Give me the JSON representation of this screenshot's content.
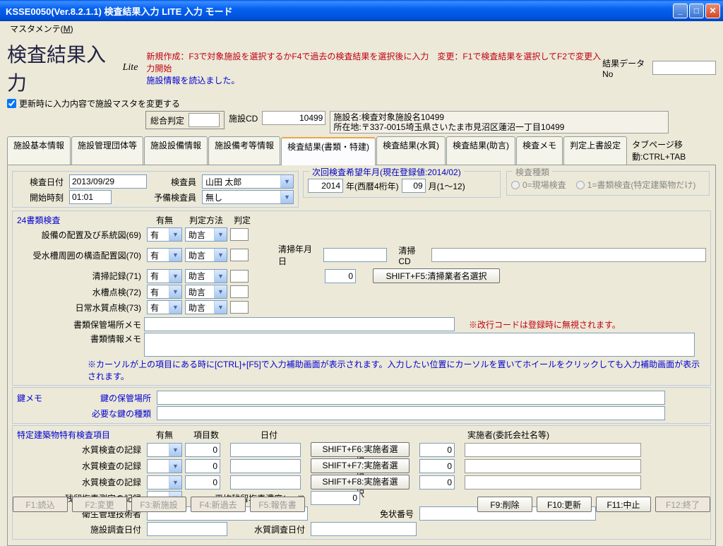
{
  "window": {
    "title": "KSSE0050(Ver.8.2.1.1) 検査結果入力 LITE 入力 モード"
  },
  "menu": {
    "master": "マスタメンテ(",
    "master_u": "M",
    "master_after": ")"
  },
  "header": {
    "page_title": "検査結果入力",
    "lite": "Lite",
    "instruction": "新規作成：F3で対象施設を選択するかF4で過去の検査結果を選択後に入力　変更：F1で検査結果を選択してF2で変更入力開始",
    "loaded": "施設情報を読込ました。",
    "checkbox_label": "更新時に入力内容で施設マスタを変更する",
    "result_data_no_label": "結果データNo",
    "result_data_no": "",
    "overall_label": "総合判定",
    "overall_value": "",
    "facility_cd_label": "施設CD",
    "facility_cd": "10499",
    "facility_name": "施設名:検査対象施設名10499",
    "facility_addr": "所在地:〒337-0015埼玉県さいたま市見沼区蓮沼一丁目10499"
  },
  "tabs": {
    "t1": "施設基本情報",
    "t2": "施設管理団体等",
    "t3": "施設設備情報",
    "t4": "施設備考等情報",
    "t5": "検査結果(書類・特建)",
    "t6": "検査結果(水質)",
    "t7": "検査結果(助言)",
    "t8": "検査メモ",
    "t9": "判定上書設定",
    "hint": "タブページ移動:CTRL+TAB"
  },
  "insp": {
    "date_label": "検査日付",
    "date": "2013/09/29",
    "start_label": "開始時刻",
    "start": "01:01",
    "inspector_label": "検査員",
    "inspector": "山田 太郎",
    "pre_label": "予備検査員",
    "pre": "無し",
    "next_label": "次回検査希望年月(現在登録値:2014/02)",
    "next_year": "2014",
    "next_year_help": "年(西暦4桁年)",
    "next_month": "09",
    "next_month_help": "月(1～12)",
    "type_legend": "検査種類",
    "type_opt0": "0=現場検査",
    "type_opt1": "1=書類検査(特定建築物だけ)"
  },
  "doc24": {
    "title": "24書類検査",
    "col_umu": "有無",
    "col_method": "判定方法",
    "col_judge": "判定",
    "rows": [
      {
        "label": "設備の配置及び系統図(69)",
        "umu": "有",
        "method": "助言"
      },
      {
        "label": "受水槽周囲の構造配置図(70)",
        "umu": "有",
        "method": "助言"
      },
      {
        "label": "清掃記録(71)",
        "umu": "有",
        "method": "助言"
      },
      {
        "label": "水槽点検(72)",
        "umu": "有",
        "method": "助言"
      },
      {
        "label": "日常水質点検(73)",
        "umu": "有",
        "method": "助言"
      }
    ],
    "clean_date_label": "清掃年月日",
    "clean_date": "",
    "clean_cd_label": "清掃CD",
    "clean_cd": "0",
    "clean_name": "",
    "clean_btn": "SHIFT+F5:清掃業者名選択",
    "storage_label": "書類保管場所メモ",
    "storage": "",
    "info_label": "書類情報メモ",
    "info": "",
    "note_red": "※改行コードは登録時に無視されます。",
    "hint": "※カーソルが上の項目にある時に[CTRL]+[F5]で入力補助画面が表示されます。入力したい位置にカーソルを置いてホイールをクリックしても入力補助画面が表示されます。"
  },
  "key": {
    "title": "鍵メモ",
    "loc_label": "鍵の保管場所",
    "loc": "",
    "type_label": "必要な鍵の種類",
    "type": ""
  },
  "special": {
    "title": "特定建築物特有検査項目",
    "col_umu": "有無",
    "col_count": "項目数",
    "col_date": "日付",
    "col_impl": "実施者(委託会社名等)",
    "rows": [
      {
        "label": "水質検査の記録",
        "btn": "SHIFT+F6:実施者選択"
      },
      {
        "label": "水質検査の記録",
        "btn": "SHIFT+F7:実施者選択"
      },
      {
        "label": "水質検査の記録",
        "btn": "SHIFT+F8:実施者選択"
      }
    ],
    "count_default": "0",
    "impl_default": "0",
    "residual_label": "残留塩素測定の記録",
    "residual_conc_label": "平均残留塩素濃度(mg/ℓ)",
    "residual_conc": "0",
    "tech_label": "衛生管理技術者",
    "tech": "",
    "license_label": "免状番号",
    "license": "",
    "survey_date_label": "施設調査日付",
    "survey_date": "",
    "water_date_label": "水質調査日付",
    "water_date": ""
  },
  "fkeys": {
    "f1": "F1:読込",
    "f2": "F2:変更",
    "f3": "F3:新施設",
    "f4": "F4:新過去",
    "f5": "F5:報告書",
    "f9": "F9:削除",
    "f10": "F10:更新",
    "f11": "F11:中止",
    "f12": "F12:終了"
  }
}
